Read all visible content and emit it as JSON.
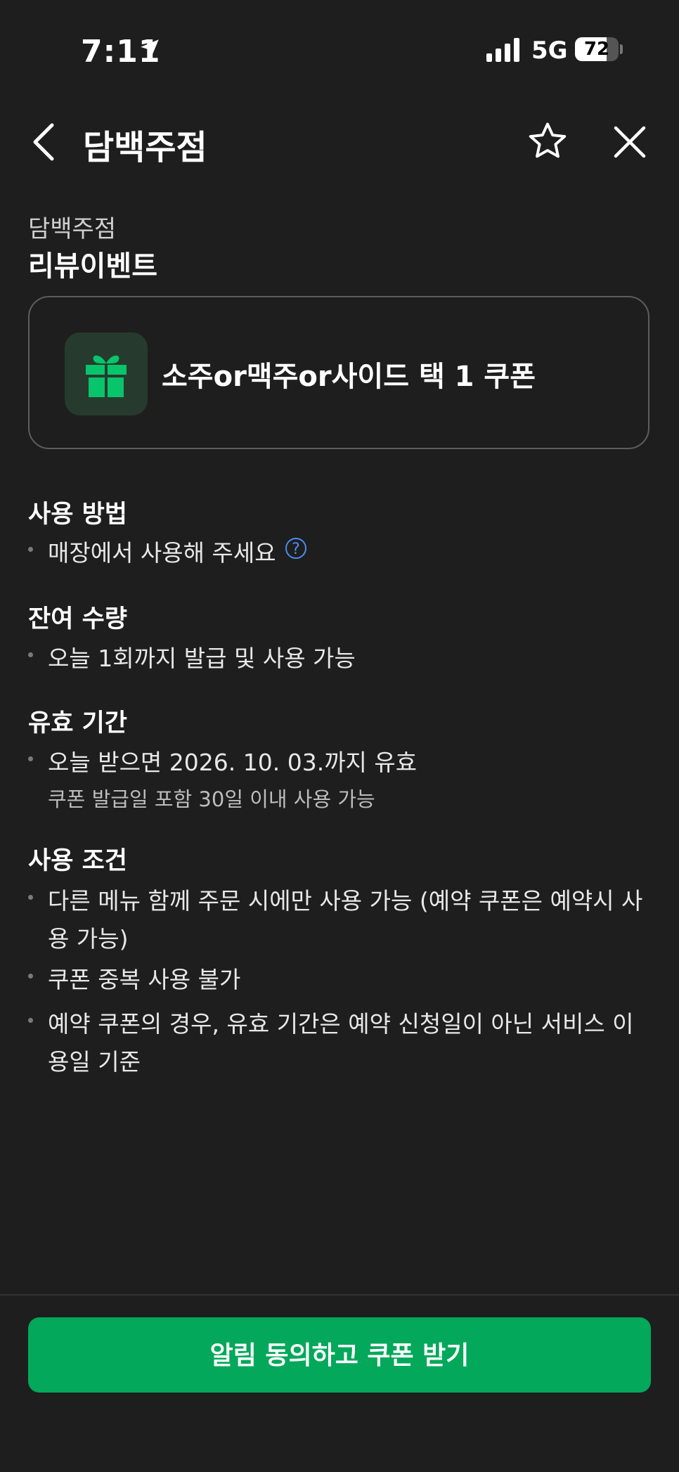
{
  "status_bar": {
    "time": "7:11",
    "network": "5G",
    "battery": "72",
    "battery_level": 0.72
  },
  "header": {
    "title": "담백주점"
  },
  "store_name": "담백주점",
  "event_title": "리뷰이벤트",
  "coupon": {
    "name": "소주or맥주or사이드 택 1 쿠폰"
  },
  "sections": {
    "usage": {
      "title": "사용 방법",
      "items": [
        "매장에서 사용해 주세요"
      ],
      "help": "?"
    },
    "remaining": {
      "title": "잔여 수량",
      "items": [
        "오늘 1회까지 발급 및 사용 가능"
      ]
    },
    "validity": {
      "title": "유효 기간",
      "items": [
        "오늘 받으면 2026. 10. 03.까지 유효"
      ],
      "note": "쿠폰 발급일 포함 30일 이내 사용 가능"
    },
    "conditions": {
      "title": "사용 조건",
      "items": [
        [
          "다른 메뉴 함께 주문 시에만 사용 가능 (예약 쿠폰은 예약시 사",
          "용 가능)"
        ],
        [
          "쿠폰 중복 사용 불가"
        ],
        [
          "예약 쿠폰의 경우, 유효 기간은 예약 신청일이 아닌 서비스 이",
          "용일 기준"
        ]
      ]
    }
  },
  "cta": {
    "label": "알림 동의하고 쿠폰 받기"
  },
  "colors": {
    "background": "#1e1e1f",
    "accent_green": "#03a85a",
    "help_blue": "#4e8cf0"
  }
}
